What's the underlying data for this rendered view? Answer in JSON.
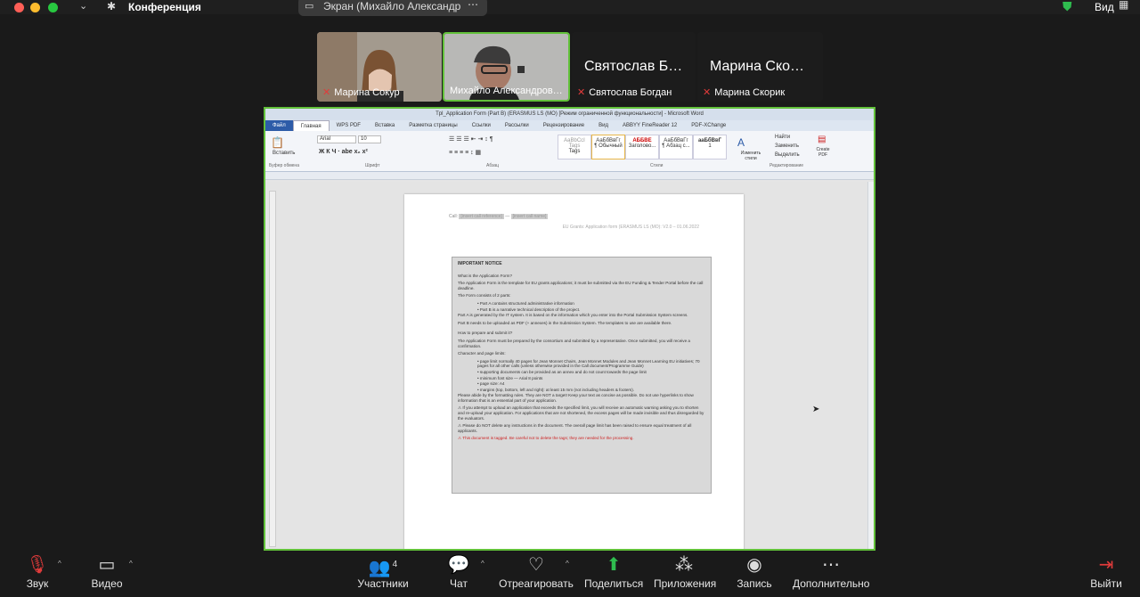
{
  "window": {
    "title": "Конференция"
  },
  "share_tab": {
    "label": "Экран (Михайло Александр…"
  },
  "view_menu": {
    "label": "Вид"
  },
  "participants": [
    {
      "name": "Марина Сокур",
      "muted": true
    },
    {
      "name": "Михайло Александров…",
      "muted": false
    },
    {
      "name": "Святослав Богдан",
      "display": "Святослав Б…",
      "muted": true
    },
    {
      "name": "Марина Скорик",
      "display": "Марина Ско…",
      "muted": true
    }
  ],
  "word": {
    "title": "Tpl_Application Form (Part B) (ERASMUS LS (MO) [Режим ограниченной функциональности] - Microsoft Word",
    "tabs": [
      "Файл",
      "Главная",
      "WPS PDF",
      "Вставка",
      "Разметка страницы",
      "Ссылки",
      "Рассылки",
      "Рецензирование",
      "Вид",
      "ABBYY FineReader 12",
      "PDF-XChange"
    ],
    "ribbon": {
      "paste": "Вставить",
      "font": "Arial",
      "size": "10",
      "clipboard": "Буфер обмена",
      "font_group": "Шрифт",
      "para_group": "Абзац",
      "styles_group": "Стили",
      "edit_group": "Редактирование",
      "styles": [
        {
          "sample": "AaBbCcI Tags",
          "name": "Tags"
        },
        {
          "sample": "АаБбВвГг",
          "name": "¶ Обычный"
        },
        {
          "sample": "АББВЕ",
          "name": "Заголово..."
        },
        {
          "sample": "АаБбВвГг",
          "name": "¶ Абзац с..."
        },
        {
          "sample": "ааБбВвГ",
          "name": "1"
        }
      ],
      "change_styles": "Изменить стили",
      "find": "Найти",
      "replace": "Заменить",
      "select": "Выделить",
      "create_pdf": "Create PDF"
    },
    "doc": {
      "call_label": "Call:",
      "call_field1": "[insert call reference]",
      "call_field2": "[insert call name]",
      "header": "EU Grants: Application form (ERASMUS LS (MO): V2.0 – 01.06.2022",
      "notice_title": "IMPORTANT NOTICE",
      "what_q": "What is the Application Form?",
      "p1": "The Application Form is the template for EU grants applications; it must be submitted via the EU Funding & Tender Portal before the call deadline.",
      "p2": "The Form consists of 2 parts:",
      "b1": "Part A contains structured administrative information",
      "b2": "Part B is a narrative technical description of the project.",
      "p3": "Part A is generated by the IT system. It is based on the information which you enter into the Portal Submission System screens.",
      "p4": "Part B needs to be uploaded as PDF (+ annexes) in the Submission System. The templates to use are available there.",
      "how_q": "How to prepare and submit it?",
      "p5": "The Application Form must be prepared by the consortium and submitted by a representative. Once submitted, you will receive a confirmation.",
      "p6": "Character and page limits:",
      "c1": "page limit normally 40 pages for Jean Monnet Chairs, Jean Monnet Modules and Jean Monnet Learning EU initiatives; 70 pages for all other calls (unless otherwise provided in the Call document/Programme Guide)",
      "c2": "supporting documents can be provided as an annex and do not count towards the page limit",
      "c3": "minimum font size — Arial 8 points",
      "c4": "page size: A4",
      "c5": "margins (top, bottom, left and right): at least 15 mm (not including headers & footers).",
      "p7": "Please abide by the formatting rules. They are NOT a target! Keep your text as concise as possible. Do not use hyperlinks to show information that is an essential part of your application.",
      "w1": "⚠ If you attempt to upload an application that exceeds the specified limit, you will receive an automatic warning asking you to shorten and re-upload your application. For applications that are not shortened, the excess pages will be made invisible and thus disregarded by the evaluators.",
      "w2": "⚠ Please do NOT delete any instructions in the document. The overall page limit has been raised to ensure equal treatment of all applicants.",
      "w3": "⚠ This document is tagged. Be careful not to delete the tags; they are needed for the processing."
    }
  },
  "toolbar": {
    "audio": "Звук",
    "video": "Видео",
    "participants": "Участники",
    "participants_count": "4",
    "chat": "Чат",
    "react": "Отреагировать",
    "share": "Поделиться",
    "apps": "Приложения",
    "record": "Запись",
    "more": "Дополнительно",
    "leave": "Выйти"
  }
}
